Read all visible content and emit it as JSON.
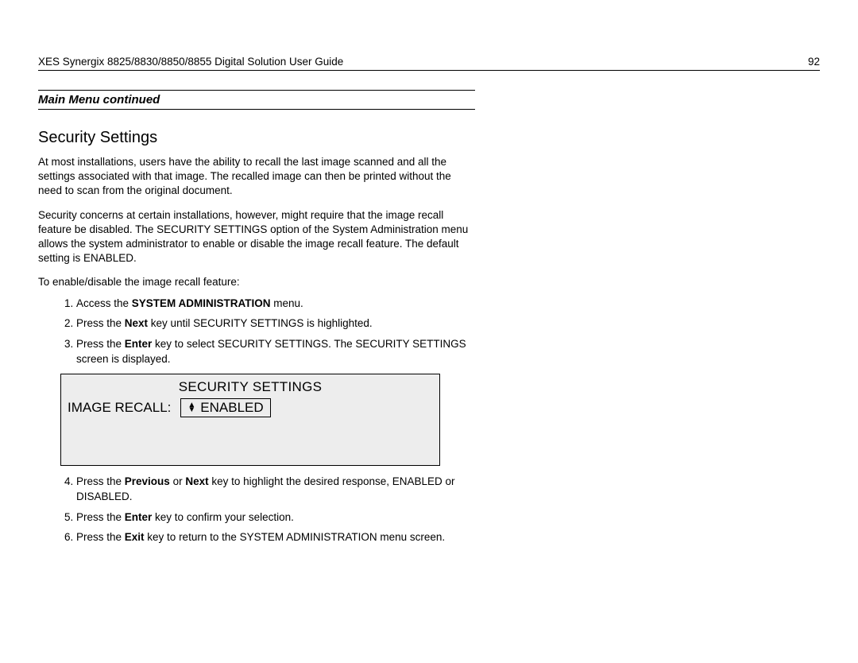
{
  "header": {
    "doc_title": "XES Synergix 8825/8830/8850/8855 Digital Solution User Guide",
    "page_number": "92"
  },
  "section_header": "Main Menu continued",
  "title": "Security Settings",
  "para1": "At most installations, users have the ability to recall the last image scanned and all the settings associated with that image.  The recalled image can then be printed without the need to scan from the original document.",
  "para2": "Security concerns at certain installations, however, might require that the image recall feature be disabled.  The SECURITY SETTINGS option of the System Administration menu allows the system administrator to enable or disable the image recall feature.  The default setting is ENABLED.",
  "lead": "To enable/disable the image recall feature:",
  "steps": {
    "s1_pre": "Access the ",
    "s1_bold": "SYSTEM ADMINISTRATION",
    "s1_post": " menu.",
    "s2_pre": "Press the ",
    "s2_bold": "Next",
    "s2_post": " key until SECURITY SETTINGS is highlighted.",
    "s3_pre": "Press the ",
    "s3_bold": "Enter",
    "s3_post": " key to select SECURITY SETTINGS.  The SECURITY SETTINGS screen is displayed.",
    "s4_pre": "Press the ",
    "s4_bold1": "Previous",
    "s4_mid": " or ",
    "s4_bold2": "Next",
    "s4_post": " key to highlight the desired response, ENABLED or DISABLED.",
    "s5_pre": "Press the ",
    "s5_bold": "Enter",
    "s5_post": " key to confirm your selection.",
    "s6_pre": "Press the ",
    "s6_bold": "Exit",
    "s6_post": " key to return to the SYSTEM ADMINISTRATION menu screen."
  },
  "screen": {
    "title": "SECURITY SETTINGS",
    "label": "IMAGE RECALL:",
    "value": "ENABLED"
  }
}
